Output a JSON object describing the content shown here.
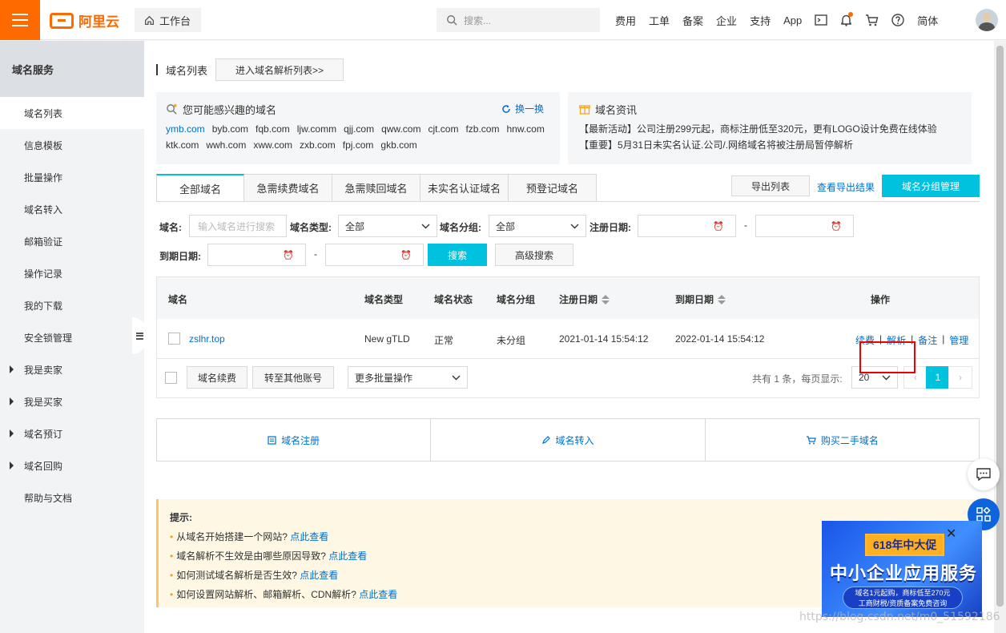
{
  "topbar": {
    "logo_text": "阿里云",
    "workbench": "工作台",
    "search_placeholder": "搜索...",
    "nav": [
      "费用",
      "工单",
      "备案",
      "企业",
      "支持",
      "App"
    ],
    "lang": "简体"
  },
  "sidebar": {
    "title": "域名服务",
    "items": [
      {
        "label": "域名列表",
        "active": true
      },
      {
        "label": "信息模板"
      },
      {
        "label": "批量操作"
      },
      {
        "label": "域名转入"
      },
      {
        "label": "邮箱验证"
      },
      {
        "label": "操作记录"
      },
      {
        "label": "我的下载"
      },
      {
        "label": "安全锁管理"
      },
      {
        "label": "我是卖家",
        "expandable": true
      },
      {
        "label": "我是买家",
        "expandable": true
      },
      {
        "label": "域名预订",
        "expandable": true
      },
      {
        "label": "域名回购",
        "expandable": true
      },
      {
        "label": "帮助与文档"
      }
    ]
  },
  "page": {
    "title": "域名列表",
    "enter_dns": "进入域名解析列表>>"
  },
  "recommend": {
    "title": "您可能感兴趣的域名",
    "refresh": "换一换",
    "domains": [
      "ymb.com",
      "byb.com",
      "fqb.com",
      "ljw.comm",
      "qjj.com",
      "qww.com",
      "cjt.com",
      "fzb.com",
      "hnw.com",
      "ktk.com",
      "wwh.com",
      "xww.com",
      "zxb.com",
      "fpj.com",
      "gkb.com"
    ]
  },
  "news": {
    "title": "域名资讯",
    "lines": [
      "【最新活动】公司注册299元起，商标注册低至320元，更有LOGO设计免费在线体验",
      "【重要】5月31日未实名认证.公司/.网络域名将被注册局暂停解析"
    ]
  },
  "tabs": [
    "全部域名",
    "急需续费域名",
    "急需赎回域名",
    "未实名认证域名",
    "预登记域名"
  ],
  "actions": {
    "export": "导出列表",
    "view_export": "查看导出结果",
    "group_manage": "域名分组管理"
  },
  "filters": {
    "domain_label": "域名:",
    "domain_placeholder": "输入域名进行搜索",
    "type_label": "域名类型:",
    "type_value": "全部",
    "group_label": "域名分组:",
    "group_value": "全部",
    "reg_date_label": "注册日期:",
    "exp_date_label": "到期日期:",
    "dash": "-",
    "search": "搜索",
    "advanced": "高级搜索"
  },
  "table": {
    "headers": {
      "domain": "域名",
      "type": "域名类型",
      "status": "域名状态",
      "group": "域名分组",
      "reg_date": "注册日期",
      "exp_date": "到期日期",
      "ops": "操作"
    },
    "rows": [
      {
        "domain": "zslhr.top",
        "type": "New gTLD",
        "status": "正常",
        "group": "未分组",
        "reg_date": "2021-01-14 15:54:12",
        "exp_date": "2022-01-14 15:54:12",
        "ops": [
          "续费",
          "解析",
          "备注",
          "管理"
        ]
      }
    ],
    "sep": "|"
  },
  "footer": {
    "renew": "域名续费",
    "transfer": "转至其他账号",
    "more_ops": "更多批量操作",
    "total_text": "共有 1 条，每页显示:",
    "page_size": "20",
    "current_page": "1",
    "prev": "‹",
    "next": "›"
  },
  "shortcuts": [
    "域名注册",
    "域名转入",
    "购买二手域名"
  ],
  "tips": {
    "title": "提示:",
    "items": [
      {
        "text": "从域名开始搭建一个网站?",
        "link": "点此查看"
      },
      {
        "text": "域名解析不生效是由哪些原因导致?",
        "link": "点此查看"
      },
      {
        "text": "如何测试域名解析是否生效?",
        "link": "点此查看"
      },
      {
        "text": "如何设置网站解析、邮箱解析、CDN解析?",
        "link": "点此查看"
      }
    ]
  },
  "ad": {
    "tag": "618年中大促",
    "headline": "中小企业应用服务",
    "line1": "域名1元起购，商标低至270元",
    "line2": "工商财税/资质备案免费咨询",
    "close": "✕"
  },
  "watermark": "https://blog.csdn.net/m0_51592186",
  "colors": {
    "brand": "#ff6a00",
    "primary": "#00c1de",
    "link": "#0070cc",
    "highlight": "#ee0000"
  }
}
